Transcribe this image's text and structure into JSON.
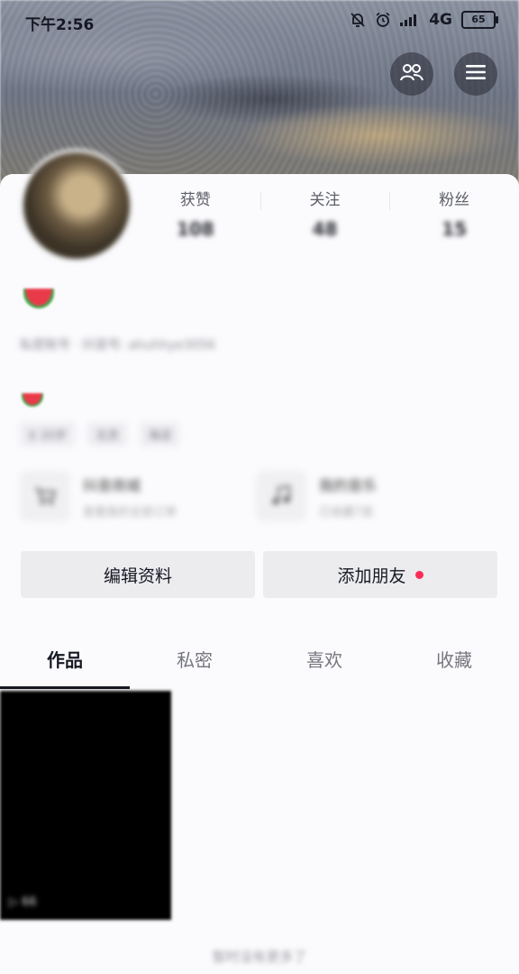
{
  "status_bar": {
    "time": "下午2:56",
    "network": "4G",
    "battery": "65"
  },
  "header": {
    "friends_icon": "people-icon",
    "menu_icon": "hamburger-menu-icon"
  },
  "profile": {
    "stats": [
      {
        "label": "获赞",
        "value": "108"
      },
      {
        "label": "关注",
        "value": "48"
      },
      {
        "label": "粉丝",
        "value": "15"
      }
    ],
    "id_line": "私密账号 · 抖音号: ahuhhye3056",
    "tags": [
      "♀ 20岁",
      "北京",
      "海淀"
    ],
    "features": [
      {
        "title": "抖音商城",
        "subtitle": "查看我的全部订单"
      },
      {
        "title": "我的音乐",
        "subtitle": "已收藏7首"
      }
    ]
  },
  "actions": {
    "edit_profile": "编辑资料",
    "add_friend": "添加朋友"
  },
  "tabs": [
    {
      "label": "作品",
      "active": true
    },
    {
      "label": "私密",
      "active": false
    },
    {
      "label": "喜欢",
      "active": false
    },
    {
      "label": "收藏",
      "active": false
    }
  ],
  "works": [
    {
      "play_count": "▷ 66"
    }
  ],
  "footer_note": "暂时没有更多了",
  "colors": {
    "accent_dot": "#fe2c55",
    "text_primary": "#161823"
  }
}
